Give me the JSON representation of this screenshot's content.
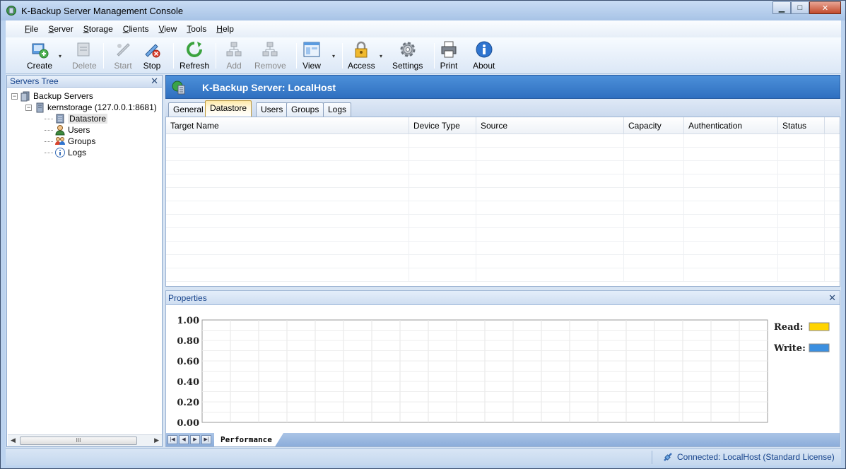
{
  "window": {
    "title": "K-Backup Server Management Console",
    "controls": {
      "minimize": "▁",
      "maximize": "□",
      "close": "✕"
    }
  },
  "menu": [
    "File",
    "Server",
    "Storage",
    "Clients",
    "View",
    "Tools",
    "Help"
  ],
  "toolbar": {
    "create": "Create",
    "delete": "Delete",
    "start": "Start",
    "stop": "Stop",
    "refresh": "Refresh",
    "add": "Add",
    "remove": "Remove",
    "view": "View",
    "access": "Access",
    "settings": "Settings",
    "print": "Print",
    "about": "About",
    "dropdown_glyph": "▾"
  },
  "servers_tree": {
    "title": "Servers Tree",
    "close": "✕",
    "root": "Backup Servers",
    "server": "kernstorage (127.0.0.1:8681)",
    "children": [
      "Datastore",
      "Users",
      "Groups",
      "Logs"
    ],
    "expanded_glyph": "−",
    "scroll_thumb": "III",
    "scroll_left": "◀",
    "scroll_right": "▶"
  },
  "server_header": {
    "title": "K-Backup Server: LocalHost"
  },
  "tabs": [
    "General",
    "Datastore",
    "Users",
    "Groups",
    "Logs"
  ],
  "active_tab": "Datastore",
  "grid": {
    "columns": [
      "Target Name",
      "Device Type",
      "Source",
      "Capacity",
      "Authentication",
      "Status"
    ],
    "rows": []
  },
  "properties": {
    "title": "Properties",
    "close": "✕",
    "bottom_tab": "Performance",
    "nav": [
      "|◀",
      "◀",
      "▶",
      "▶|"
    ]
  },
  "chart_data": {
    "type": "line",
    "y_ticks": [
      "1.00",
      "0.80",
      "0.60",
      "0.40",
      "0.20",
      "0.00"
    ],
    "ylim": [
      0,
      1
    ],
    "grid": true,
    "legend_position": "right",
    "series": [
      {
        "name": "Read:",
        "color": "#ffd400",
        "values": []
      },
      {
        "name": "Write:",
        "color": "#3b8fe0",
        "values": []
      }
    ]
  },
  "status": {
    "connection": "Connected: LocalHost (Standard License)"
  }
}
